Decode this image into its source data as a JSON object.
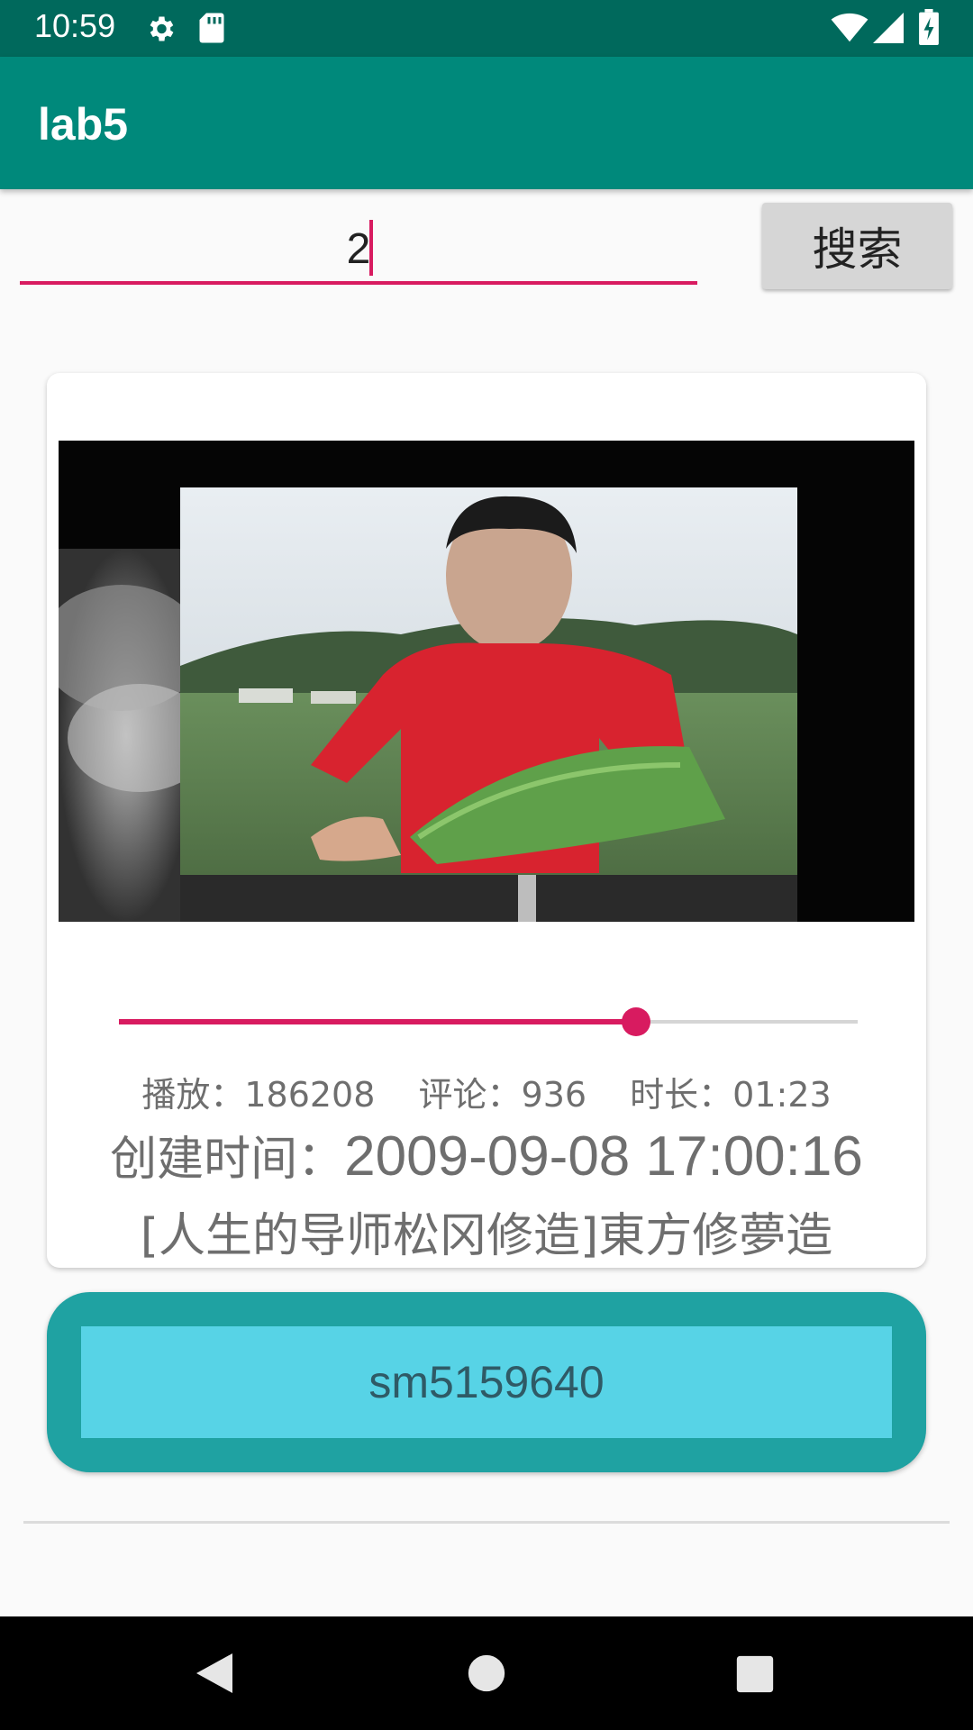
{
  "status_bar": {
    "time": "10:59",
    "icons": [
      "gear-icon",
      "sd-card-icon",
      "wifi-icon",
      "signal-icon",
      "battery-icon"
    ]
  },
  "app_bar": {
    "title": "lab5"
  },
  "search": {
    "value": "2",
    "button_label": "搜索"
  },
  "video_card": {
    "progress_fraction": 0.7,
    "stats": {
      "play_label": "播放：",
      "play_count": "186208",
      "comment_label": "评论：",
      "comment_count": "936",
      "duration_label": "时长：",
      "duration": "01:23"
    },
    "created_label": "创建时间：",
    "created_value": "2009-09-08 17:00:16",
    "title": "[人生的导师松冈修造]東方修夢造"
  },
  "video_id": "sm5159640",
  "colors": {
    "status_bar": "#00695c",
    "app_bar": "#00897b",
    "accent": "#d81b60",
    "id_outer": "#1fa2a2",
    "id_inner": "#57d3e6"
  },
  "nav_bar": {
    "icons": [
      "back-icon",
      "home-icon",
      "recents-icon"
    ]
  }
}
